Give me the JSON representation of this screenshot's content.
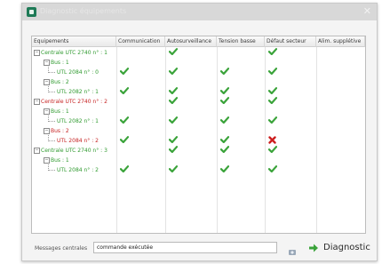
{
  "window": {
    "title": "Diagnostic équipements",
    "close_glyph": "✕"
  },
  "columns": [
    "Equipements",
    "Communication",
    "Autosurveillance",
    "Tension basse",
    "Défaut secteur",
    "Alim. supplétive"
  ],
  "rows": [
    {
      "label": "Centrale UTC 2740 n° : 1",
      "color": "green",
      "level": 0,
      "toggle": "⊟",
      "status": [
        "",
        "",
        "ok",
        "",
        "ok",
        ""
      ]
    },
    {
      "label": "Bus : 1",
      "color": "green",
      "level": 1,
      "toggle": "⊟",
      "status": [
        "",
        "",
        "",
        "",
        "",
        ""
      ]
    },
    {
      "label": "UTL 2084 n° : 0",
      "color": "green",
      "level": 2,
      "toggle": "",
      "status": [
        "",
        "ok",
        "ok",
        "ok",
        "ok",
        ""
      ]
    },
    {
      "label": "Bus : 2",
      "color": "green",
      "level": 1,
      "toggle": "⊟",
      "status": [
        "",
        "",
        "",
        "",
        "",
        ""
      ]
    },
    {
      "label": "UTL 2082 n° : 1",
      "color": "green",
      "level": 2,
      "toggle": "",
      "status": [
        "",
        "ok",
        "ok",
        "ok",
        "ok",
        ""
      ]
    },
    {
      "label": "Centrale UTC 2740 n° : 2",
      "color": "red",
      "level": 0,
      "toggle": "⊟",
      "status": [
        "",
        "",
        "ok",
        "ok",
        "ok",
        ""
      ]
    },
    {
      "label": "Bus : 1",
      "color": "green",
      "level": 1,
      "toggle": "⊟",
      "status": [
        "",
        "",
        "",
        "",
        "",
        ""
      ]
    },
    {
      "label": "UTL 2082 n° : 1",
      "color": "green",
      "level": 2,
      "toggle": "",
      "status": [
        "",
        "ok",
        "ok",
        "ok",
        "ok",
        ""
      ]
    },
    {
      "label": "Bus : 2",
      "color": "red",
      "level": 1,
      "toggle": "⊟",
      "status": [
        "",
        "",
        "",
        "",
        "",
        ""
      ]
    },
    {
      "label": "UTL 2084 n° : 2",
      "color": "red",
      "level": 2,
      "toggle": "",
      "status": [
        "",
        "ok",
        "ok",
        "ok",
        "error",
        ""
      ]
    },
    {
      "label": "Centrale UTC 2740 n° : 3",
      "color": "green",
      "level": 0,
      "toggle": "⊟",
      "status": [
        "",
        "",
        "ok",
        "ok",
        "ok",
        ""
      ]
    },
    {
      "label": "Bus : 1",
      "color": "green",
      "level": 1,
      "toggle": "⊟",
      "status": [
        "",
        "",
        "",
        "",
        "",
        ""
      ]
    },
    {
      "label": "UTL 2084 n° : 2",
      "color": "green",
      "level": 2,
      "toggle": "",
      "status": [
        "",
        "ok",
        "ok",
        "ok",
        "ok",
        ""
      ]
    }
  ],
  "status_icons": {
    "ok": "check-icon",
    "error": "cross-icon"
  },
  "colors": {
    "ok": "#3aa33a",
    "error": "#cc1f1f",
    "label_green": "#2f9a2f",
    "label_red": "#c62222",
    "title_bar": "#d8d8d8"
  },
  "footer": {
    "message_label": "Messages centrales",
    "message_value": "commande exécutée",
    "refresh_icon": "refresh-icon",
    "diagnostic_label": "Diagnostic",
    "diagnostic_icon": "green-arrow-right-icon"
  }
}
